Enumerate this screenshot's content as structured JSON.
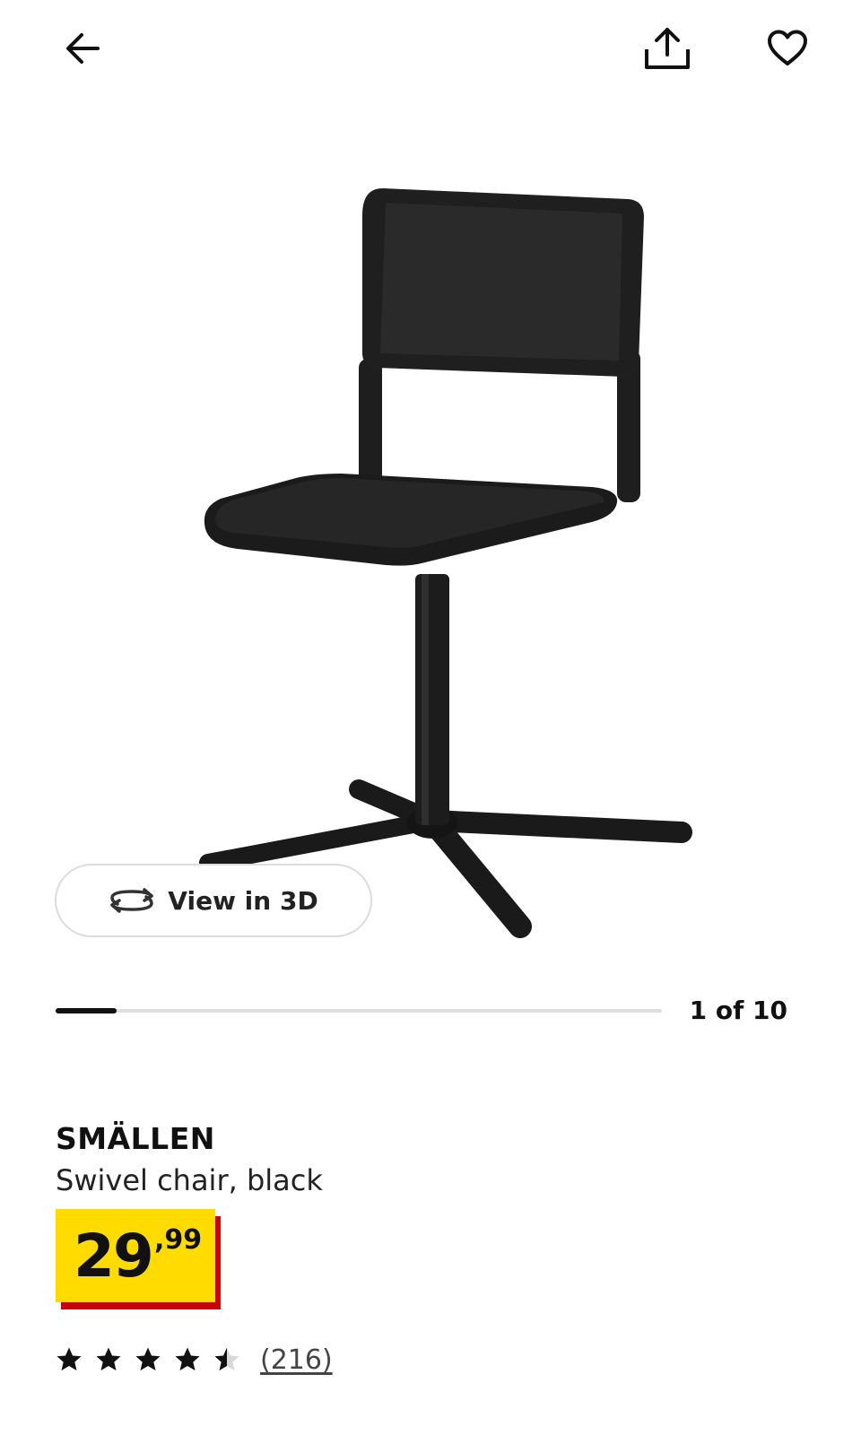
{
  "product": {
    "name": "SMÄLLEN",
    "description": "Swivel chair, black",
    "price_whole": "29",
    "price_decimal": ",99",
    "rating": 4.5,
    "review_count": "(216)"
  },
  "gallery": {
    "counter": "1 of 10",
    "progress": 0.1,
    "view3d_label": "View in 3D"
  },
  "icons": {
    "back": "arrow-left-icon",
    "share": "share-icon",
    "favorite": "heart-icon",
    "view3d": "rotate-3d-icon",
    "star": "star-icon"
  },
  "colors": {
    "price_yellow": "#ffdb00",
    "price_red": "#cc0008",
    "chair": "#1d1d1d"
  }
}
